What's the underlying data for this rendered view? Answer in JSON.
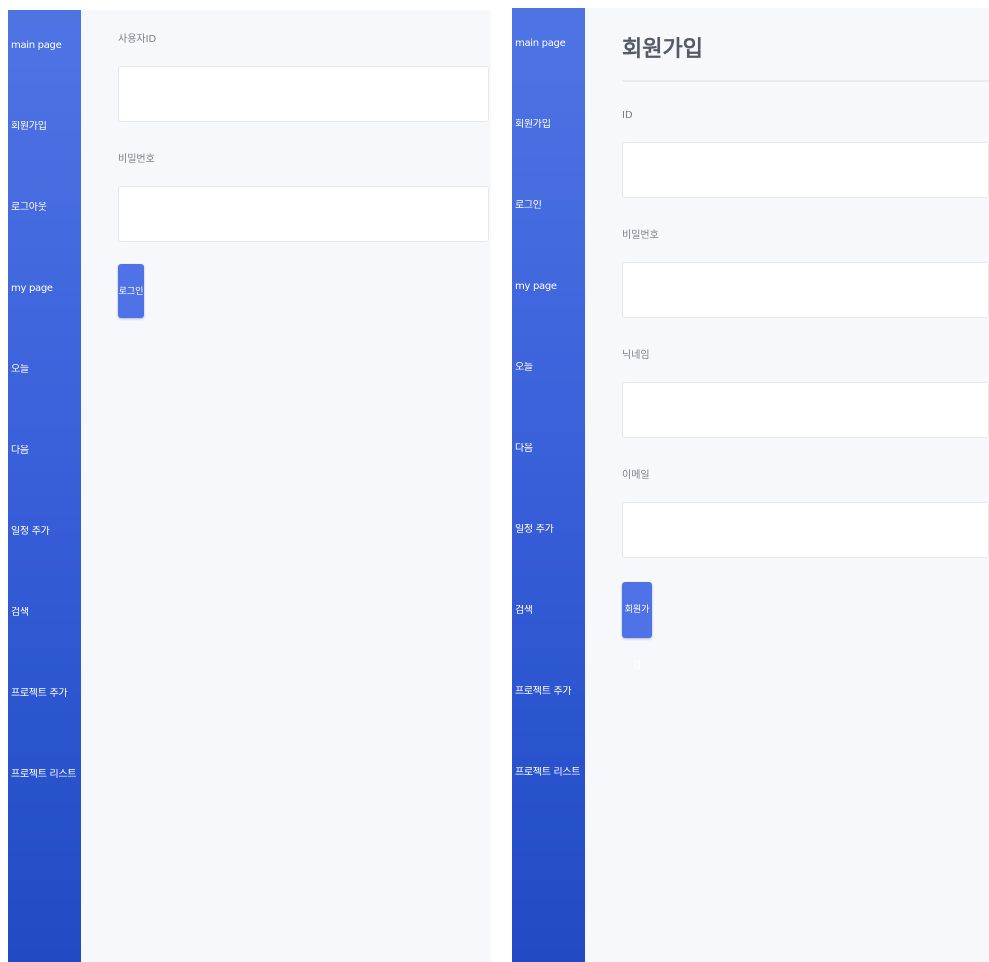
{
  "login_panel": {
    "sidebar": {
      "items": [
        {
          "label": "main page"
        },
        {
          "label": "회원가입"
        },
        {
          "label": "로그아웃"
        },
        {
          "label": "my page"
        },
        {
          "label": "오늘"
        },
        {
          "label": "다음"
        },
        {
          "label": "일정 추가"
        },
        {
          "label": "검색"
        },
        {
          "label": "프로젝트 추가"
        },
        {
          "label": "프로젝트 리스트"
        }
      ]
    },
    "form": {
      "username_label": "사용자ID",
      "username_value": "",
      "password_label": "비밀번호",
      "password_value": "",
      "submit_label": "로그인"
    }
  },
  "signup_panel": {
    "sidebar": {
      "items": [
        {
          "label": "main page"
        },
        {
          "label": "회원가입"
        },
        {
          "label": "로그인"
        },
        {
          "label": "my page"
        },
        {
          "label": "오늘"
        },
        {
          "label": "다음"
        },
        {
          "label": "일정 추가"
        },
        {
          "label": "검색"
        },
        {
          "label": "프로젝트 추가"
        },
        {
          "label": "프로젝트 리스트"
        }
      ]
    },
    "form": {
      "title": "회원가입",
      "id_label": "ID",
      "id_value": "",
      "password_label": "비밀번호",
      "password_value": "",
      "nickname_label": "닉네임",
      "nickname_value": "",
      "email_label": "이메일",
      "email_value": "",
      "submit_label": "회원가입"
    }
  },
  "colors": {
    "sidebar_top": "#4e74e4",
    "sidebar_bottom": "#224ac5",
    "button": "#4f73e6",
    "background": "#f6f8fc"
  }
}
